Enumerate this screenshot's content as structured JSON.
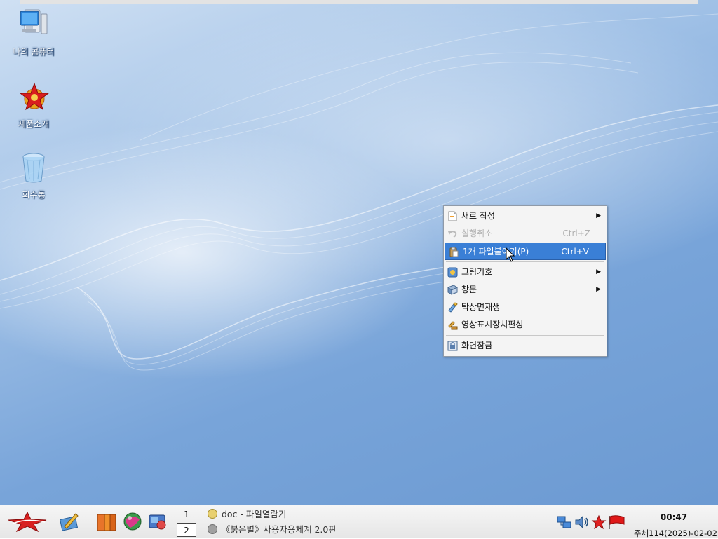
{
  "desktop": {
    "icons": [
      {
        "name": "my-computer",
        "label": "나의 콤퓨터",
        "icon": "computer-monitor-icon"
      },
      {
        "name": "product-intro",
        "label": "제품소개",
        "icon": "red-star-emblem-icon"
      },
      {
        "name": "recycle-bin",
        "label": "회수통",
        "icon": "trash-bin-icon"
      }
    ]
  },
  "context_menu": {
    "items": [
      {
        "label": "새로 작성",
        "shortcut": "",
        "submenu": true,
        "disabled": false,
        "highlighted": false,
        "icon": "new-document-icon"
      },
      {
        "label": "실행취소",
        "shortcut": "Ctrl+Z",
        "submenu": false,
        "disabled": true,
        "highlighted": false,
        "icon": "undo-icon"
      },
      {
        "label": "1개 파일붙이기(P)",
        "shortcut": "Ctrl+V",
        "submenu": false,
        "disabled": false,
        "highlighted": true,
        "icon": "paste-icon"
      },
      {
        "label": "그림기호",
        "shortcut": "",
        "submenu": true,
        "disabled": false,
        "highlighted": false,
        "icon": "icon-view-icon"
      },
      {
        "label": "창문",
        "shortcut": "",
        "submenu": true,
        "disabled": false,
        "highlighted": false,
        "icon": "window-icon"
      },
      {
        "label": "탁상면재생",
        "shortcut": "",
        "submenu": false,
        "disabled": false,
        "highlighted": false,
        "icon": "refresh-desktop-icon"
      },
      {
        "label": "영상표시장치편성",
        "shortcut": "",
        "submenu": false,
        "disabled": false,
        "highlighted": false,
        "icon": "display-settings-icon"
      },
      {
        "label": "화면잠금",
        "shortcut": "",
        "submenu": false,
        "disabled": false,
        "highlighted": false,
        "icon": "lock-screen-icon"
      }
    ],
    "submenu_arrow": "▶"
  },
  "taskbar": {
    "launchers": [
      "start-menu-icon",
      "editor-icon",
      "file-manager-icon",
      "browser-globe-icon",
      "media-player-icon"
    ],
    "workspaces": {
      "ws1": "1",
      "ws2": "2"
    },
    "tasks": {
      "task1": "doc - 파일열람기",
      "task2": "《붉은별》사용자용체계 2.0판"
    },
    "tray": [
      "network-icon",
      "volume-icon",
      "notification-icon",
      "flag-icon"
    ],
    "clock": {
      "time": "00:47",
      "date": "주체114(2025)-02-02"
    }
  },
  "colors": {
    "menu_highlight": "#3a7fd6",
    "desktop_blue": "#78a4d9",
    "taskbar_bg": "#eeeeee"
  }
}
